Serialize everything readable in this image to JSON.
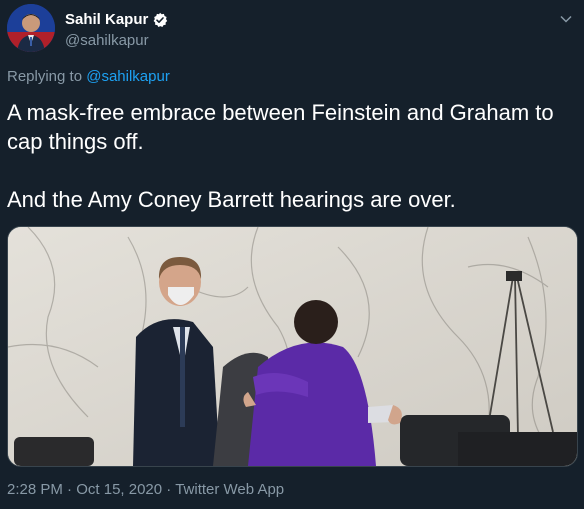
{
  "author": {
    "display_name": "Sahil Kapur",
    "handle": "@sahilkapur"
  },
  "reply": {
    "prefix": "Replying to",
    "handle": "@sahilkapur"
  },
  "tweet": {
    "text": "A mask-free embrace between Feinstein and Graham to cap things off.\n\nAnd the Amy Coney Barrett hearings are over."
  },
  "meta": {
    "time": "2:28 PM",
    "sep1": " · ",
    "date": "Oct 15, 2020",
    "sep2": " · ",
    "source": "Twitter Web App"
  },
  "colors": {
    "background": "#15202b",
    "secondary_text": "#8899a6",
    "link": "#1da1f2"
  },
  "icons": {
    "verified": "verified-badge-icon",
    "more": "chevron-down-icon"
  }
}
